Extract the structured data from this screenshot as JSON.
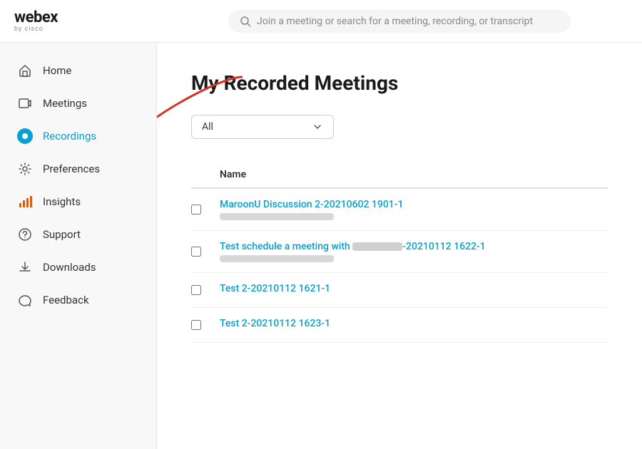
{
  "logo": {
    "webex": "webex",
    "cisco": "by cisco"
  },
  "search": {
    "placeholder": "Join a meeting or search for a meeting, recording, or transcript"
  },
  "sidebar": {
    "items": [
      {
        "id": "home",
        "label": "Home",
        "icon": "home",
        "active": false
      },
      {
        "id": "meetings",
        "label": "Meetings",
        "icon": "meetings",
        "active": false
      },
      {
        "id": "recordings",
        "label": "Recordings",
        "icon": "recordings",
        "active": true
      },
      {
        "id": "preferences",
        "label": "Preferences",
        "icon": "preferences",
        "active": false
      },
      {
        "id": "insights",
        "label": "Insights",
        "icon": "insights",
        "active": false
      },
      {
        "id": "support",
        "label": "Support",
        "icon": "support",
        "active": false
      },
      {
        "id": "downloads",
        "label": "Downloads",
        "icon": "downloads",
        "active": false
      },
      {
        "id": "feedback",
        "label": "Feedback",
        "icon": "feedback",
        "active": false
      }
    ]
  },
  "main": {
    "title": "My Recorded Meetings",
    "filter": {
      "selected": "All"
    },
    "table": {
      "column_name": "Name",
      "rows": [
        {
          "id": "row1",
          "title": "MaroonU Discussion 2-20210602 1901-1",
          "subtitle": "blurred",
          "checked": false
        },
        {
          "id": "row2",
          "title": "Test schedule a meeting with ██████-20210112 1622-1",
          "subtitle": "blurred",
          "checked": false
        },
        {
          "id": "row3",
          "title": "Test 2-20210112 1621-1",
          "subtitle": "",
          "checked": false
        },
        {
          "id": "row4",
          "title": "Test 2-20210112 1623-1",
          "subtitle": "",
          "checked": false
        }
      ]
    }
  }
}
